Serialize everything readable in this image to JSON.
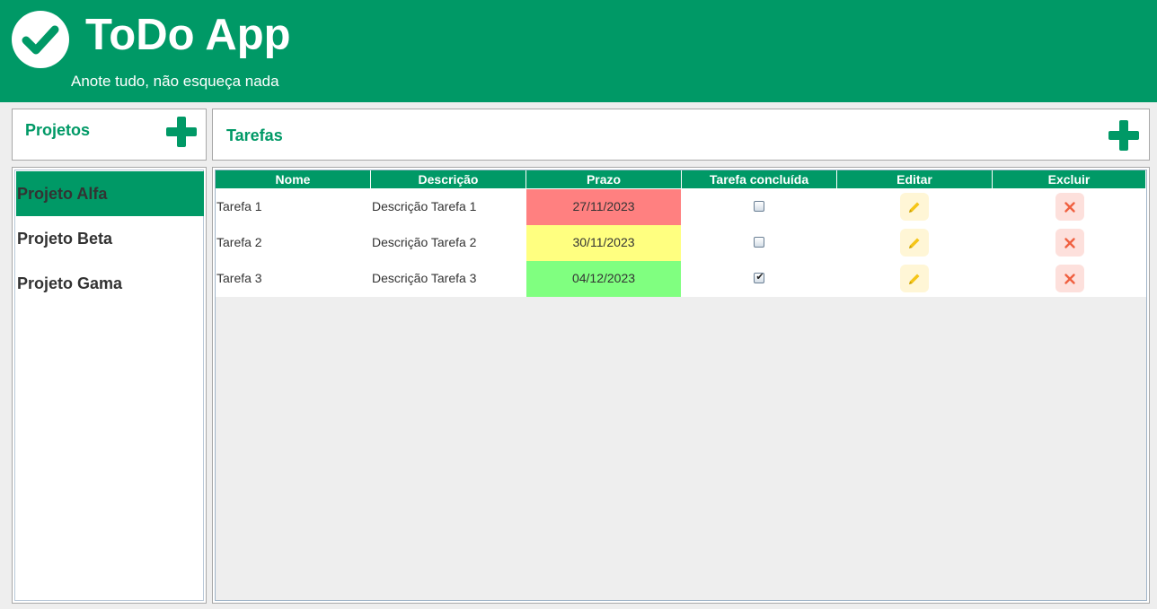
{
  "header": {
    "title": "ToDo App",
    "subtitle": "Anote tudo, não esqueça nada",
    "logo_icon": "check-circle-icon"
  },
  "projects": {
    "heading": "Projetos",
    "add_icon": "plus-icon",
    "items": [
      {
        "label": "Projeto Alfa",
        "selected": true
      },
      {
        "label": "Projeto Beta",
        "selected": false
      },
      {
        "label": "Projeto Gama",
        "selected": false
      }
    ]
  },
  "tasks": {
    "heading": "Tarefas",
    "add_icon": "plus-icon",
    "columns": [
      "Nome",
      "Descrição",
      "Prazo",
      "Tarefa concluída",
      "Editar",
      "Excluir"
    ],
    "rows": [
      {
        "name": "Tarefa 1",
        "description": "Descrição Tarefa 1",
        "due": "27/11/2023",
        "due_color": "#ff8080",
        "done": false
      },
      {
        "name": "Tarefa 2",
        "description": "Descrição Tarefa 2",
        "due": "30/11/2023",
        "due_color": "#ffff80",
        "done": false
      },
      {
        "name": "Tarefa 3",
        "description": "Descrição Tarefa 3",
        "due": "04/12/2023",
        "due_color": "#80ff80",
        "done": true
      }
    ],
    "edit_icon": "pencil-icon",
    "delete_icon": "x-icon"
  },
  "colors": {
    "brand": "#009966",
    "background": "#eeeeee",
    "edit_icon": "#f5c518",
    "delete_icon": "#f06040"
  }
}
